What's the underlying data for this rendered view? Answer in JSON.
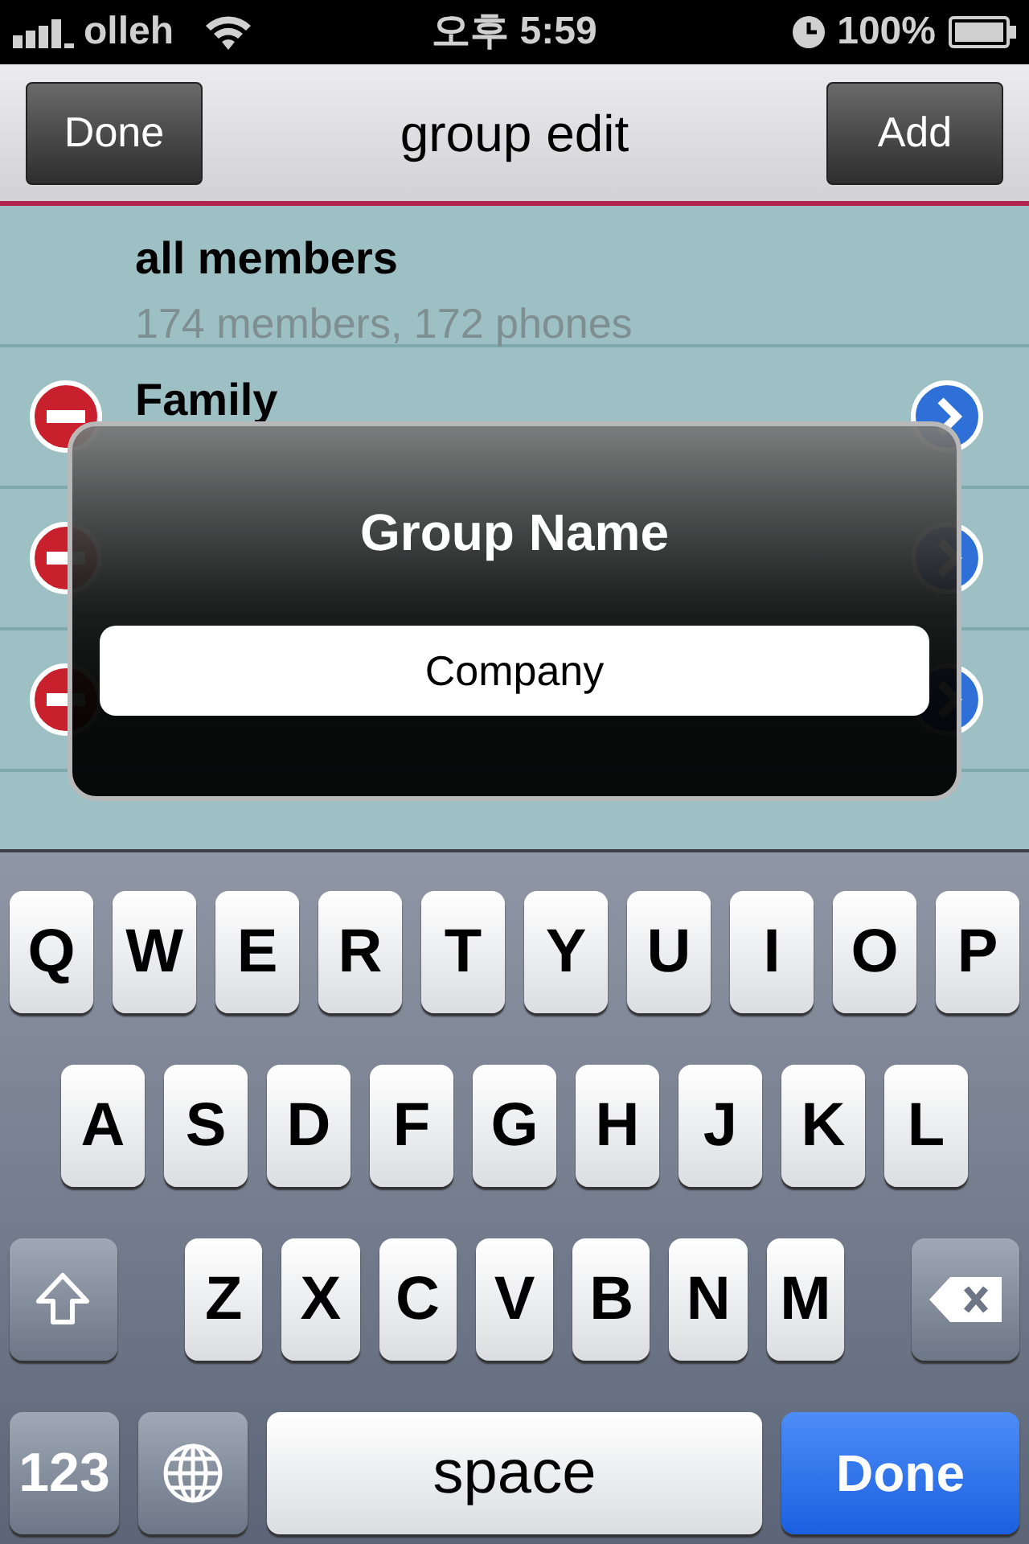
{
  "status_bar": {
    "carrier": "olleh",
    "time": "오후 5:59",
    "battery": "100%"
  },
  "nav_bar": {
    "title": "group edit",
    "left_button": "Done",
    "right_button": "Add"
  },
  "groups": [
    {
      "name": "all members",
      "subtitle": "174 members, 172 phones",
      "editable": false
    },
    {
      "name": "Family",
      "editable": true
    },
    {
      "editable": true
    },
    {
      "editable": true
    }
  ],
  "dialog": {
    "title": "Group Name",
    "value": "Company"
  },
  "keyboard": {
    "letter_rows": [
      [
        {
          "kind": "letter",
          "label": "Q"
        },
        {
          "kind": "letter",
          "label": "W"
        },
        {
          "kind": "letter",
          "label": "E"
        },
        {
          "kind": "letter",
          "label": "R"
        },
        {
          "kind": "letter",
          "label": "T"
        },
        {
          "kind": "letter",
          "label": "Y"
        },
        {
          "kind": "letter",
          "label": "U"
        },
        {
          "kind": "letter",
          "label": "I"
        },
        {
          "kind": "letter",
          "label": "O"
        },
        {
          "kind": "letter",
          "label": "P"
        }
      ],
      [
        {
          "kind": "letter",
          "label": "A"
        },
        {
          "kind": "letter",
          "label": "S"
        },
        {
          "kind": "letter",
          "label": "D"
        },
        {
          "kind": "letter",
          "label": "F"
        },
        {
          "kind": "letter",
          "label": "G"
        },
        {
          "kind": "letter",
          "label": "H"
        },
        {
          "kind": "letter",
          "label": "J"
        },
        {
          "kind": "letter",
          "label": "K"
        },
        {
          "kind": "letter",
          "label": "L"
        }
      ],
      [
        {
          "kind": "shift"
        },
        {
          "kind": "letter",
          "label": "Z"
        },
        {
          "kind": "letter",
          "label": "X"
        },
        {
          "kind": "letter",
          "label": "C"
        },
        {
          "kind": "letter",
          "label": "V"
        },
        {
          "kind": "letter",
          "label": "B"
        },
        {
          "kind": "letter",
          "label": "N"
        },
        {
          "kind": "letter",
          "label": "M"
        },
        {
          "kind": "delete"
        }
      ]
    ],
    "bottom_keys": [
      {
        "kind": "mode",
        "label": "123"
      },
      {
        "kind": "globe"
      },
      {
        "kind": "space",
        "label": "space"
      },
      {
        "kind": "done",
        "label": "Done"
      }
    ]
  }
}
